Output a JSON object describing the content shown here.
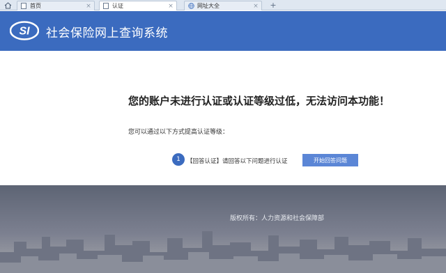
{
  "browser": {
    "tabs": [
      {
        "label": "首页",
        "icon": "page-icon",
        "active": false
      },
      {
        "label": "认证",
        "icon": "page-icon",
        "active": true
      },
      {
        "label": "网址大全",
        "icon": "globe-icon",
        "active": false
      }
    ],
    "new_tab_symbol": "+",
    "close_symbol": "×"
  },
  "header": {
    "logo_text": "SI",
    "title": "社会保险网上查询系统",
    "color": "#3b6bbf"
  },
  "main": {
    "message": "您的账户未进行认证或认证等级过低，无法访问本功能！",
    "instruction": "您可以通过以下方式提高认证等级：",
    "step_number": "1",
    "step_text": "【回答认证】请回答以下问题进行认证",
    "button_label": "开始回答问题"
  },
  "footer": {
    "copyright": "版权所有：人力资源和社会保障部"
  }
}
